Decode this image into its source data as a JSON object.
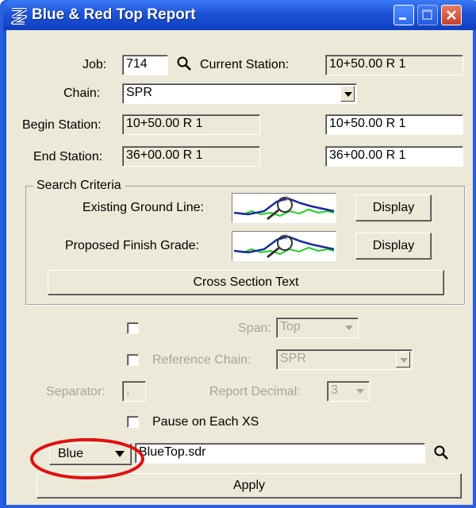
{
  "window": {
    "title": "Blue & Red Top Report"
  },
  "job": {
    "label": "Job:",
    "value": "714",
    "current_station_label": "Current Station:",
    "current_station_value": "10+50.00 R 1"
  },
  "chain": {
    "label": "Chain:",
    "value": "SPR"
  },
  "begin_station": {
    "label": "Begin Station:",
    "value": "10+50.00 R 1",
    "input_value": "10+50.00 R 1"
  },
  "end_station": {
    "label": "End Station:",
    "value": "36+00.00 R 1",
    "input_value": "36+00.00 R 1"
  },
  "search_criteria": {
    "title": "Search Criteria",
    "existing_ground_label": "Existing Ground Line:",
    "proposed_finish_label": "Proposed Finish Grade:",
    "display_label": "Display",
    "cross_section_label": "Cross Section Text"
  },
  "options": {
    "span_label": "Span:",
    "span_value": "Top",
    "reference_chain_label": "Reference Chain:",
    "reference_chain_value": "SPR",
    "separator_label": "Separator:",
    "separator_value": ",",
    "report_decimal_label": "Report Decimal:",
    "report_decimal_value": "3",
    "pause_label": "Pause on Each XS"
  },
  "output": {
    "color_value": "Blue",
    "file_value": "BlueTop.sdr"
  },
  "apply_label": "Apply",
  "colors": {
    "titlebar": "#1d53d6",
    "dialog_bg": "#ece9d8",
    "annotation": "#e01010",
    "ground_line": "#22cc22",
    "grade_line": "#1a2a9a"
  }
}
